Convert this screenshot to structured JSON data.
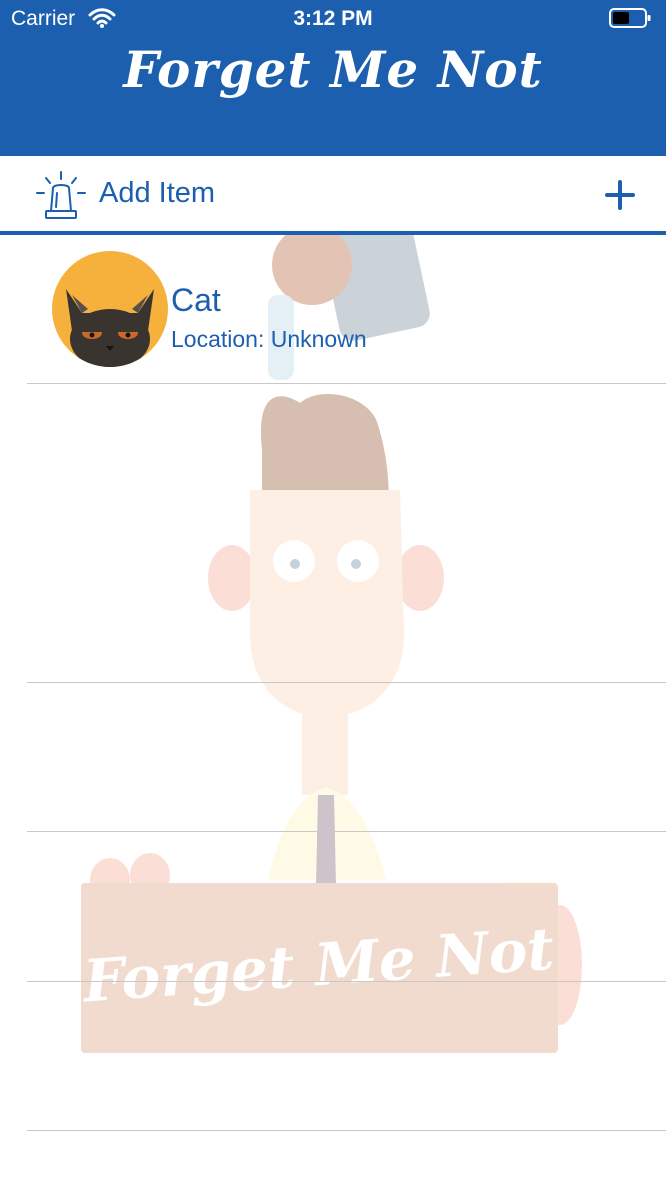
{
  "status_bar": {
    "carrier": "Carrier",
    "time": "3:12 PM",
    "wifi_icon": "wifi-icon",
    "battery_icon": "battery-icon"
  },
  "header": {
    "title": "Forget Me Not",
    "background_color": "#1c5fae"
  },
  "add_bar": {
    "icon": "alarm-siren-icon",
    "label": "Add Item",
    "add_icon": "plus-icon"
  },
  "items": [
    {
      "name": "Cat",
      "location": "Location: Unknown",
      "avatar_icon": "cat-avatar-icon"
    }
  ],
  "watermark": {
    "sign_text": "Forget Me Not"
  },
  "colors": {
    "accent": "#1c5fae",
    "avatar_bg": "#f6b13d",
    "separator": "#c8c8c8"
  }
}
